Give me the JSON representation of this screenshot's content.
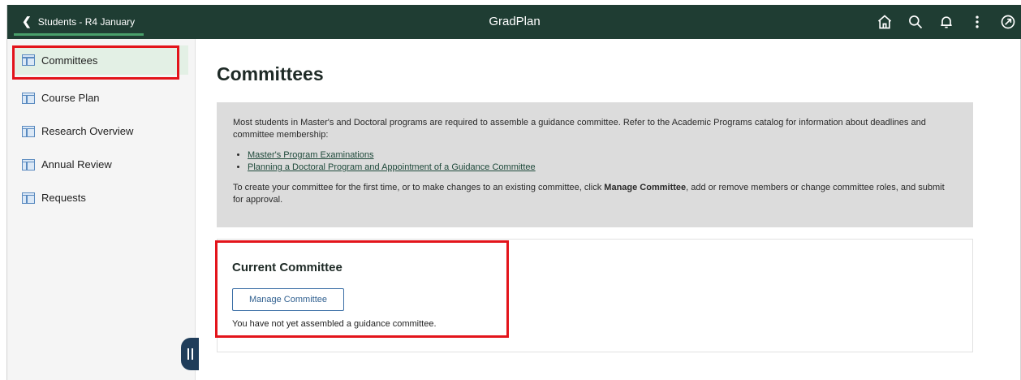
{
  "header": {
    "back_label": "Students - R4 January",
    "app_title": "GradPlan",
    "icons": [
      "home-icon",
      "search-icon",
      "bell-icon",
      "more-vertical-icon",
      "compass-icon"
    ]
  },
  "sidebar": {
    "items": [
      {
        "label": "Committees",
        "icon": "page-icon",
        "active": true
      },
      {
        "label": "Course Plan",
        "icon": "page-icon",
        "active": false
      },
      {
        "label": "Research Overview",
        "icon": "page-icon",
        "active": false
      },
      {
        "label": "Annual Review",
        "icon": "page-icon",
        "active": false
      },
      {
        "label": "Requests",
        "icon": "page-icon",
        "active": false
      }
    ]
  },
  "main": {
    "title": "Committees",
    "info": {
      "intro": "Most students in Master's and Doctoral programs are required to assemble a guidance committee. Refer to the Academic Programs catalog for information about deadlines and committee membership:",
      "links": [
        "Master's Program Examinations",
        "Planning a Doctoral Program and Appointment of a Guidance Committee"
      ],
      "instr_before": "To create your committee for the first time, or to make changes to an existing committee, click ",
      "instr_bold": "Manage Committee",
      "instr_after": ", add or remove members or change committee roles, and submit for approval."
    },
    "current_committee": {
      "title": "Current Committee",
      "button_label": "Manage Committee",
      "message": "You have not yet assembled a guidance committee."
    }
  },
  "colors": {
    "header_bg": "#1f3d33",
    "accent_green": "#49a06b",
    "highlight_red": "#e3141b",
    "button_blue": "#3a6ea5"
  }
}
